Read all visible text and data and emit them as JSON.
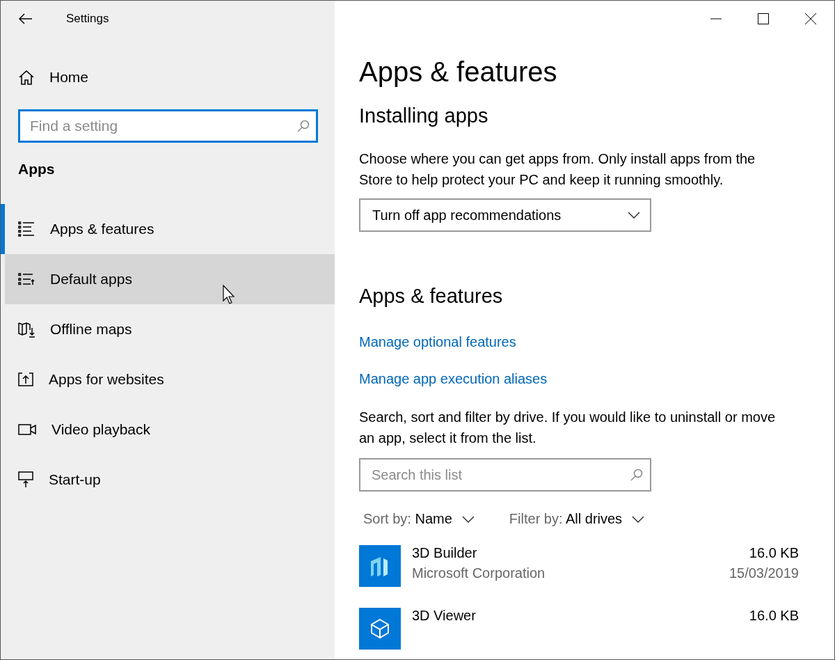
{
  "window": {
    "title": "Settings"
  },
  "sidebar": {
    "home": "Home",
    "search": {
      "placeholder": "Find a setting",
      "focused": true
    },
    "section": "Apps",
    "items": [
      {
        "label": "Apps & features",
        "selected": true,
        "hovered": false
      },
      {
        "label": "Default apps",
        "selected": false,
        "hovered": true
      },
      {
        "label": "Offline maps",
        "selected": false,
        "hovered": false
      },
      {
        "label": "Apps for websites",
        "selected": false,
        "hovered": false
      },
      {
        "label": "Video playback",
        "selected": false,
        "hovered": false
      },
      {
        "label": "Start-up",
        "selected": false,
        "hovered": false
      }
    ]
  },
  "content": {
    "title": "Apps & features",
    "installing": {
      "heading": "Installing apps",
      "description": "Choose where you can get apps from. Only install apps from the Store to help protect your PC and keep it running smoothly.",
      "dropdown": "Turn off app recommendations"
    },
    "features": {
      "heading": "Apps & features",
      "links": [
        "Manage optional features",
        "Manage app execution aliases"
      ],
      "description": "Search, sort and filter by drive. If you would like to uninstall or move an app, select it from the list.",
      "search": {
        "placeholder": "Search this list"
      },
      "sort": {
        "label": "Sort by:",
        "value": "Name"
      },
      "filter": {
        "label": "Filter by:",
        "value": "All drives"
      },
      "apps": [
        {
          "name": "3D Builder",
          "publisher": "Microsoft Corporation",
          "size": "16.0 KB",
          "date": "15/03/2019"
        },
        {
          "name": "3D Viewer",
          "size": "16.0 KB"
        }
      ]
    }
  }
}
